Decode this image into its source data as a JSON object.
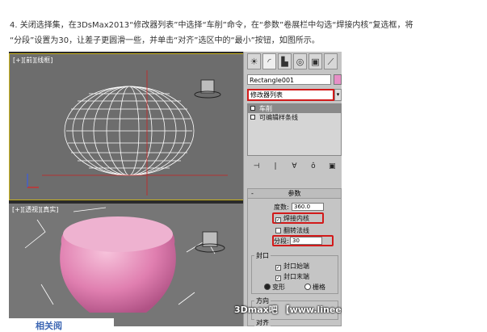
{
  "intro_text": "4. 关闭选择集，在3DsMax2013“修改器列表”中选择“车削”命令，在“参数”卷展栏中勾选“焊接内核”复选框，将\n“分段”设置为30，让差子更圆滑一些，并单击“对齐”选区中的“最小”按钮，如图所示。",
  "viewport_top": {
    "label": "[+][前][线框]"
  },
  "viewport_bottom": {
    "label": "[+][透视][真实]"
  },
  "panel": {
    "tabs": [
      "☀",
      "◜",
      "▙",
      "◎",
      "▣",
      "⟋"
    ],
    "object_name": "Rectangle001",
    "object_color": "#e68fc6",
    "modifier_list": "修改器列表",
    "stack": [
      "车削",
      "可编辑样条线"
    ],
    "tools": [
      "⊣",
      "|",
      "∀",
      "ô",
      "▣"
    ],
    "params": {
      "title": "参数",
      "degrees_label": "度数:",
      "degrees_value": "360.0",
      "weld_core": "焊接内核",
      "flip_normals": "翻转法线",
      "segments_label": "分段:",
      "segments_value": "30",
      "cap_group": "封口",
      "cap_start": "封口始端",
      "cap_end": "封口末端",
      "morph": "变形",
      "grid": "栅格",
      "direction_group": "方向",
      "align_group": "对齐"
    }
  },
  "watermark": "3Dmax吧 【www.lineeg.com/tieba/1771】",
  "footer_partial": "相关阅"
}
